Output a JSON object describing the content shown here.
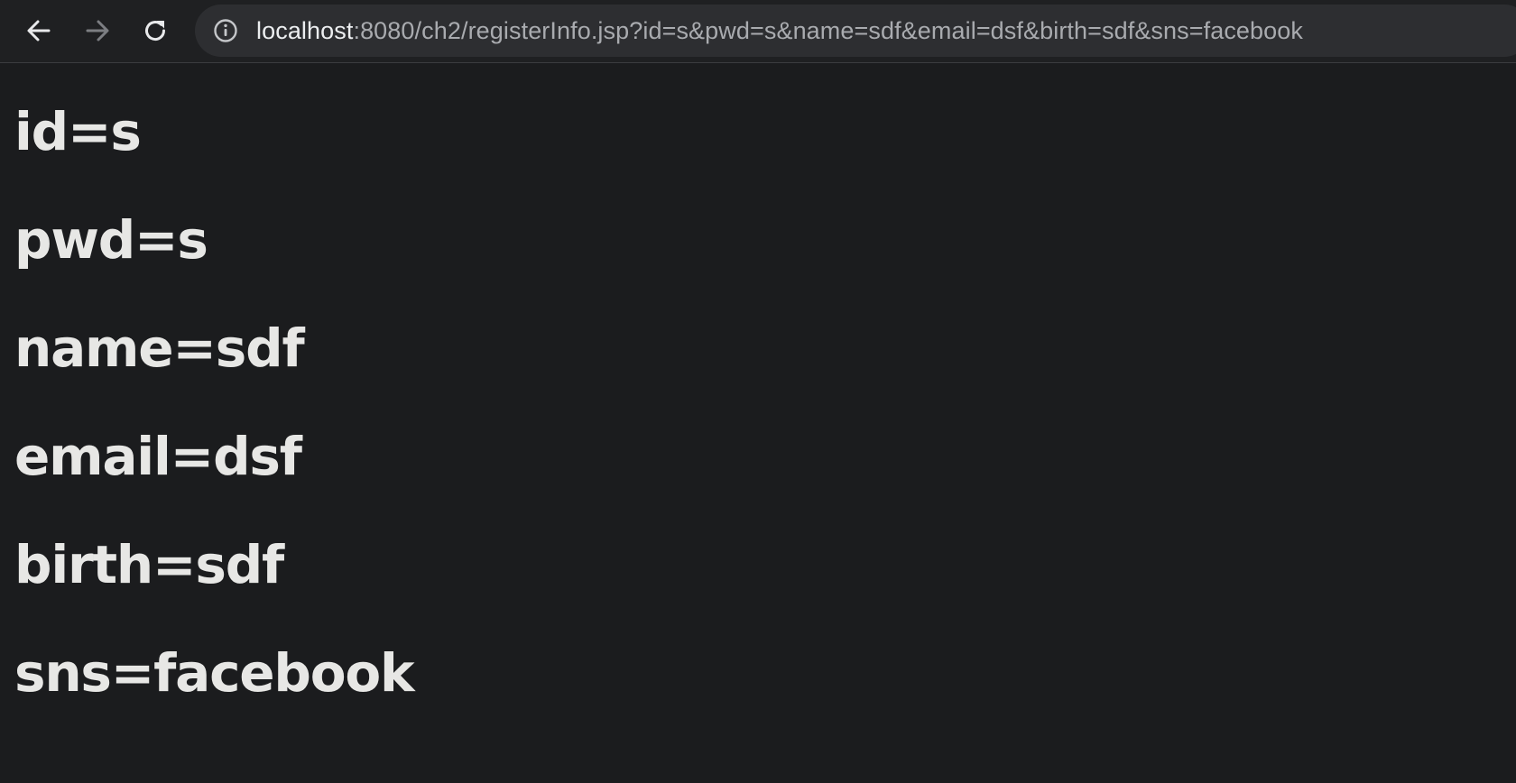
{
  "browser": {
    "toolbar": {
      "back_icon": "arrow-left-icon",
      "forward_icon": "arrow-right-icon",
      "reload_icon": "reload-icon",
      "site_info_icon": "info-icon"
    },
    "address_bar": {
      "host": "localhost",
      "path": ":8080/ch2/registerInfo.jsp?id=s&pwd=s&name=sdf&email=dsf&birth=sdf&sns=facebook"
    },
    "colors": {
      "page_background": "#1b1c1e",
      "toolbar_background": "#1f2022",
      "omnibox_background": "#2d2e31",
      "text": "#e7e7e5"
    }
  },
  "page": {
    "lines": [
      "id=s",
      "pwd=s",
      "name=sdf",
      "email=dsf",
      "birth=sdf",
      "sns=facebook"
    ]
  }
}
